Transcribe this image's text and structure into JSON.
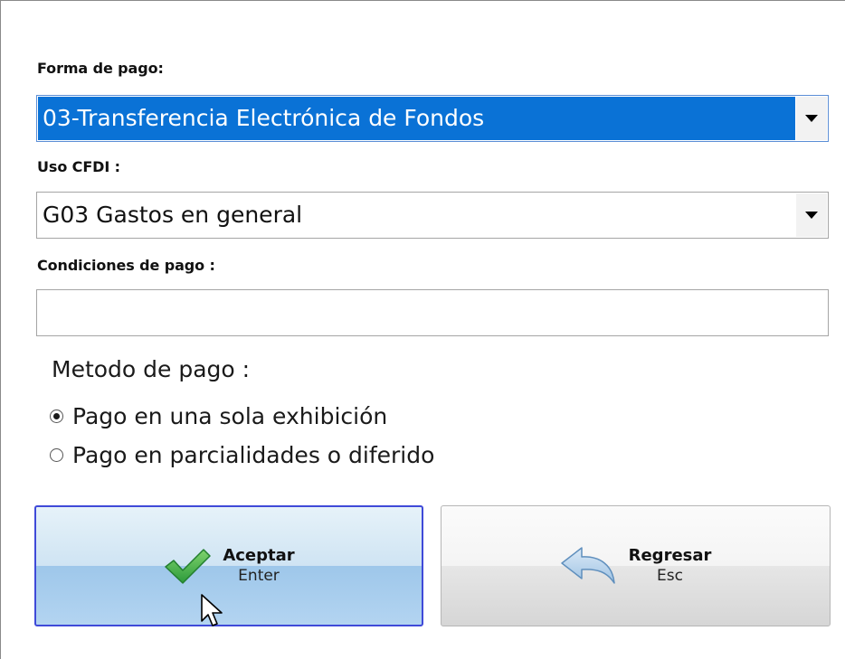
{
  "form": {
    "payment_form": {
      "label": "Forma de pago:",
      "value": "03-Transferencia Electrónica de Fondos"
    },
    "cfdi_use": {
      "label": "Uso CFDI :",
      "value": "G03 Gastos en general"
    },
    "payment_conditions": {
      "label": "Condiciones de pago :",
      "value": ""
    },
    "payment_method": {
      "title": "Metodo de pago :",
      "options": [
        {
          "label": "Pago en una sola exhibición",
          "selected": true
        },
        {
          "label": "Pago en parcialidades o diferido",
          "selected": false
        }
      ]
    }
  },
  "buttons": {
    "accept": {
      "label": "Aceptar",
      "shortcut": "Enter",
      "icon": "checkmark-icon"
    },
    "back": {
      "label": "Regresar",
      "shortcut": "Esc",
      "icon": "back-arrow-icon"
    }
  },
  "colors": {
    "selection": "#0a72d6",
    "accept_border": "#3f4ad8",
    "check_green": "#3aa845"
  }
}
